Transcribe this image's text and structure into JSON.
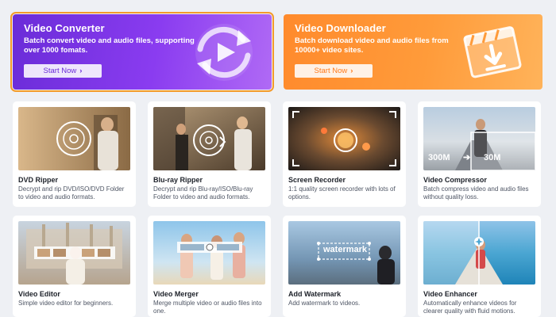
{
  "banners": {
    "converter": {
      "title": "Video Converter",
      "description": "Batch convert video and audio files, supporting over 1000 fomats.",
      "button": "Start Now",
      "accent": "#7b35e6"
    },
    "downloader": {
      "title": "Video Downloader",
      "description": "Batch download video and audio files from 10000+ video sites.",
      "button": "Start Now",
      "accent": "#ff8f32"
    }
  },
  "tools": [
    {
      "title": "DVD Ripper",
      "description": "Decrypt and rip DVD/ISO/DVD Folder to video and audio formats."
    },
    {
      "title": "Blu-ray Ripper",
      "description": "Decrypt and rip Blu-ray/ISO/Blu-ray Folder to video and audio formats."
    },
    {
      "title": "Screen Recorder",
      "description": "1:1 quality screen recorder with lots of options."
    },
    {
      "title": "Video Compressor",
      "description": "Batch compress video and audio files without quality loss.",
      "badge_from": "300M",
      "badge_to": "30M"
    },
    {
      "title": "Video Editor",
      "description": "Simple video editor for beginners."
    },
    {
      "title": "Video Merger",
      "description": "Merge multiple video or audio files into one."
    },
    {
      "title": "Add Watermark",
      "description": "Add watermark to videos.",
      "overlay": "watermark"
    },
    {
      "title": "Video Enhancer",
      "description": "Automatically enhance videos for clearer quality with fluid motions."
    }
  ]
}
